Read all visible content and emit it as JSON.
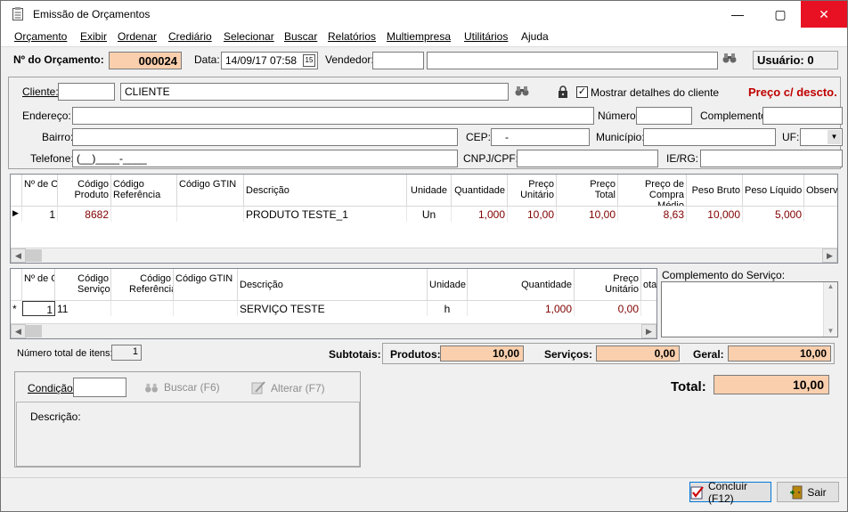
{
  "window": {
    "title": "Emissão de Orçamentos",
    "min": "—",
    "max": "▢",
    "close": "✕"
  },
  "menu": [
    "Orçamento",
    "Exibir",
    "Ordenar",
    "Crediário",
    "Selecionar",
    "Buscar",
    "Relatórios",
    "Multiempresa",
    "Utilitários",
    "Ajuda"
  ],
  "header": {
    "num_label": "Nº do Orçamento:",
    "num_value": "000024",
    "date_label": "Data:",
    "date_value": "14/09/17 07:58",
    "cal_icon": "15",
    "vendedor_label": "Vendedor:",
    "vendedor_code": "",
    "vendedor_name": "",
    "usuario": "Usuário: 0"
  },
  "cliente": {
    "label": "Cliente:",
    "code": "",
    "name": "CLIENTE",
    "mostrar": "Mostrar detalhes do cliente",
    "preco": "Preço c/ descto.",
    "endereco_label": "Endereço:",
    "numero_label": "Número:",
    "complemento_label": "Complemento:",
    "bairro_label": "Bairro:",
    "cep_label": "CEP:",
    "cep_value": "-",
    "municipio_label": "Município:",
    "uf_label": "UF:",
    "telefone_label": "Telefone:",
    "telefone_value": "(__)____-____",
    "cnpj_label": "CNPJ/CPF:",
    "ie_label": "IE/RG:"
  },
  "produtos": {
    "headers": [
      "Nº de Ordem",
      "Código Produto",
      "Código Referência",
      "Código GTIN",
      "Descrição",
      "Unidade",
      "Quantidade",
      "Preço Unitário",
      "Preço Total",
      "Preço de Compra Médio",
      "Peso Bruto",
      "Peso Líquido",
      "Observ"
    ],
    "row": {
      "ordem": "1",
      "codigo": "8682",
      "referencia": "",
      "gtin": "",
      "descricao": "PRODUTO TESTE_1",
      "unidade": "Un",
      "quantidade": "1,000",
      "unitario": "10,00",
      "total": "10,00",
      "compra": "8,63",
      "bruto": "10,000",
      "liquido": "5,000",
      "obs": ""
    }
  },
  "servicos": {
    "headers": [
      "Nº de Ordem",
      "Código Serviço",
      "Código Referência",
      "Código GTIN",
      "Descrição",
      "Unidade",
      "Quantidade",
      "Preço Unitário",
      "otal"
    ],
    "row": {
      "marker": "*",
      "ordem": "1",
      "codigo": "11",
      "referencia": "",
      "gtin": "",
      "descricao": "SERVIÇO TESTE",
      "unidade": "h",
      "quantidade": "1,000",
      "unitario": "0,00"
    },
    "complemento_label": "Complemento do Serviço:"
  },
  "totais": {
    "num_itens_label": "Número total de itens:",
    "num_itens": "1",
    "subtotais": "Subtotais:",
    "produtos_label": "Produtos:",
    "produtos": "10,00",
    "servicos_label": "Serviços:",
    "servicos": "0,00",
    "geral_label": "Geral:",
    "geral": "10,00",
    "total_label": "Total:",
    "total": "10,00"
  },
  "condicao": {
    "label": "Condição:",
    "value": "",
    "buscar": "Buscar (F6)",
    "alterar": "Alterar (F7)",
    "descricao_label": "Descrição:"
  },
  "footer": {
    "concluir": "Concluir (F12)",
    "sair": "Sair"
  }
}
